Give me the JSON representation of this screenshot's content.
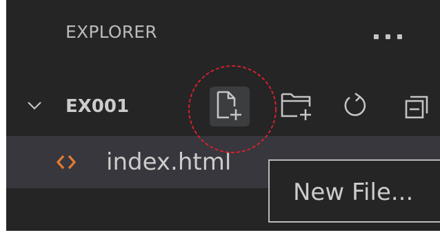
{
  "explorer": {
    "title": "EXPLORER",
    "more_icon": "ellipsis-icon"
  },
  "folder": {
    "name": "EX001",
    "expand_icon": "chevron-down-icon",
    "actions": [
      {
        "name": "new-file",
        "icon": "new-file-icon"
      },
      {
        "name": "new-folder",
        "icon": "new-folder-icon"
      },
      {
        "name": "refresh",
        "icon": "refresh-icon"
      },
      {
        "name": "collapse-all",
        "icon": "collapse-all-icon"
      }
    ]
  },
  "files": [
    {
      "name": "index.html",
      "icon": "html-file-icon",
      "icon_color": "#e37933"
    }
  ],
  "tooltip": {
    "text": "New File..."
  },
  "colors": {
    "background": "#252526",
    "selected_row": "#37373d",
    "text": "#cccccc",
    "annotation": "#e8202a"
  }
}
